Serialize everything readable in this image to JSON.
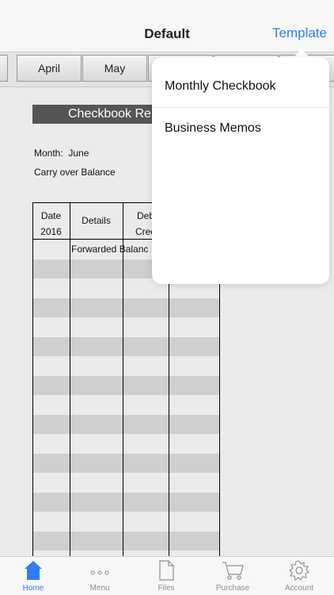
{
  "navbar": {
    "title": "Default",
    "right_button": "Template"
  },
  "month_tabs": [
    "",
    "April",
    "May",
    "",
    "",
    ""
  ],
  "sheet": {
    "title": "Checkbook Re",
    "month_label": "Month:",
    "month_value": "June",
    "carry_over": "Carry over Balance",
    "columns": {
      "date_line1": "Date",
      "date_line2": "2016",
      "details": "Details",
      "debit_line1": "Deb",
      "debit_line2": "Cred"
    },
    "forwarded": "Forwarded Balanc"
  },
  "popover": {
    "items": [
      "Monthly Checkbook",
      "Business Memos"
    ]
  },
  "tabbar": {
    "tabs": [
      {
        "label": "Home",
        "icon": "home-icon"
      },
      {
        "label": "Menu",
        "icon": "ellipsis-icon"
      },
      {
        "label": "Files",
        "icon": "document-icon"
      },
      {
        "label": "Purchase",
        "icon": "cart-icon"
      },
      {
        "label": "Account",
        "icon": "gear-icon"
      }
    ]
  },
  "colors": {
    "accent": "#2f7cf6",
    "title_band": "#555555",
    "row_shade": "#cfcfcf"
  }
}
